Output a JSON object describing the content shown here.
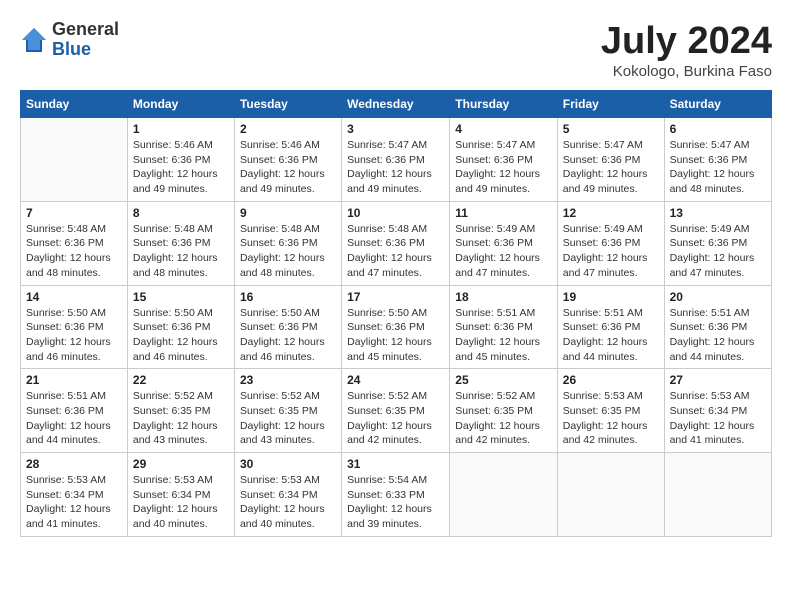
{
  "logo": {
    "general": "General",
    "blue": "Blue"
  },
  "title": "July 2024",
  "location": "Kokologo, Burkina Faso",
  "days_of_week": [
    "Sunday",
    "Monday",
    "Tuesday",
    "Wednesday",
    "Thursday",
    "Friday",
    "Saturday"
  ],
  "weeks": [
    [
      {
        "day": "",
        "info": ""
      },
      {
        "day": "1",
        "info": "Sunrise: 5:46 AM\nSunset: 6:36 PM\nDaylight: 12 hours\nand 49 minutes."
      },
      {
        "day": "2",
        "info": "Sunrise: 5:46 AM\nSunset: 6:36 PM\nDaylight: 12 hours\nand 49 minutes."
      },
      {
        "day": "3",
        "info": "Sunrise: 5:47 AM\nSunset: 6:36 PM\nDaylight: 12 hours\nand 49 minutes."
      },
      {
        "day": "4",
        "info": "Sunrise: 5:47 AM\nSunset: 6:36 PM\nDaylight: 12 hours\nand 49 minutes."
      },
      {
        "day": "5",
        "info": "Sunrise: 5:47 AM\nSunset: 6:36 PM\nDaylight: 12 hours\nand 49 minutes."
      },
      {
        "day": "6",
        "info": "Sunrise: 5:47 AM\nSunset: 6:36 PM\nDaylight: 12 hours\nand 48 minutes."
      }
    ],
    [
      {
        "day": "7",
        "info": "Sunrise: 5:48 AM\nSunset: 6:36 PM\nDaylight: 12 hours\nand 48 minutes."
      },
      {
        "day": "8",
        "info": "Sunrise: 5:48 AM\nSunset: 6:36 PM\nDaylight: 12 hours\nand 48 minutes."
      },
      {
        "day": "9",
        "info": "Sunrise: 5:48 AM\nSunset: 6:36 PM\nDaylight: 12 hours\nand 48 minutes."
      },
      {
        "day": "10",
        "info": "Sunrise: 5:48 AM\nSunset: 6:36 PM\nDaylight: 12 hours\nand 47 minutes."
      },
      {
        "day": "11",
        "info": "Sunrise: 5:49 AM\nSunset: 6:36 PM\nDaylight: 12 hours\nand 47 minutes."
      },
      {
        "day": "12",
        "info": "Sunrise: 5:49 AM\nSunset: 6:36 PM\nDaylight: 12 hours\nand 47 minutes."
      },
      {
        "day": "13",
        "info": "Sunrise: 5:49 AM\nSunset: 6:36 PM\nDaylight: 12 hours\nand 47 minutes."
      }
    ],
    [
      {
        "day": "14",
        "info": "Sunrise: 5:50 AM\nSunset: 6:36 PM\nDaylight: 12 hours\nand 46 minutes."
      },
      {
        "day": "15",
        "info": "Sunrise: 5:50 AM\nSunset: 6:36 PM\nDaylight: 12 hours\nand 46 minutes."
      },
      {
        "day": "16",
        "info": "Sunrise: 5:50 AM\nSunset: 6:36 PM\nDaylight: 12 hours\nand 46 minutes."
      },
      {
        "day": "17",
        "info": "Sunrise: 5:50 AM\nSunset: 6:36 PM\nDaylight: 12 hours\nand 45 minutes."
      },
      {
        "day": "18",
        "info": "Sunrise: 5:51 AM\nSunset: 6:36 PM\nDaylight: 12 hours\nand 45 minutes."
      },
      {
        "day": "19",
        "info": "Sunrise: 5:51 AM\nSunset: 6:36 PM\nDaylight: 12 hours\nand 44 minutes."
      },
      {
        "day": "20",
        "info": "Sunrise: 5:51 AM\nSunset: 6:36 PM\nDaylight: 12 hours\nand 44 minutes."
      }
    ],
    [
      {
        "day": "21",
        "info": "Sunrise: 5:51 AM\nSunset: 6:36 PM\nDaylight: 12 hours\nand 44 minutes."
      },
      {
        "day": "22",
        "info": "Sunrise: 5:52 AM\nSunset: 6:35 PM\nDaylight: 12 hours\nand 43 minutes."
      },
      {
        "day": "23",
        "info": "Sunrise: 5:52 AM\nSunset: 6:35 PM\nDaylight: 12 hours\nand 43 minutes."
      },
      {
        "day": "24",
        "info": "Sunrise: 5:52 AM\nSunset: 6:35 PM\nDaylight: 12 hours\nand 42 minutes."
      },
      {
        "day": "25",
        "info": "Sunrise: 5:52 AM\nSunset: 6:35 PM\nDaylight: 12 hours\nand 42 minutes."
      },
      {
        "day": "26",
        "info": "Sunrise: 5:53 AM\nSunset: 6:35 PM\nDaylight: 12 hours\nand 42 minutes."
      },
      {
        "day": "27",
        "info": "Sunrise: 5:53 AM\nSunset: 6:34 PM\nDaylight: 12 hours\nand 41 minutes."
      }
    ],
    [
      {
        "day": "28",
        "info": "Sunrise: 5:53 AM\nSunset: 6:34 PM\nDaylight: 12 hours\nand 41 minutes."
      },
      {
        "day": "29",
        "info": "Sunrise: 5:53 AM\nSunset: 6:34 PM\nDaylight: 12 hours\nand 40 minutes."
      },
      {
        "day": "30",
        "info": "Sunrise: 5:53 AM\nSunset: 6:34 PM\nDaylight: 12 hours\nand 40 minutes."
      },
      {
        "day": "31",
        "info": "Sunrise: 5:54 AM\nSunset: 6:33 PM\nDaylight: 12 hours\nand 39 minutes."
      },
      {
        "day": "",
        "info": ""
      },
      {
        "day": "",
        "info": ""
      },
      {
        "day": "",
        "info": ""
      }
    ]
  ]
}
